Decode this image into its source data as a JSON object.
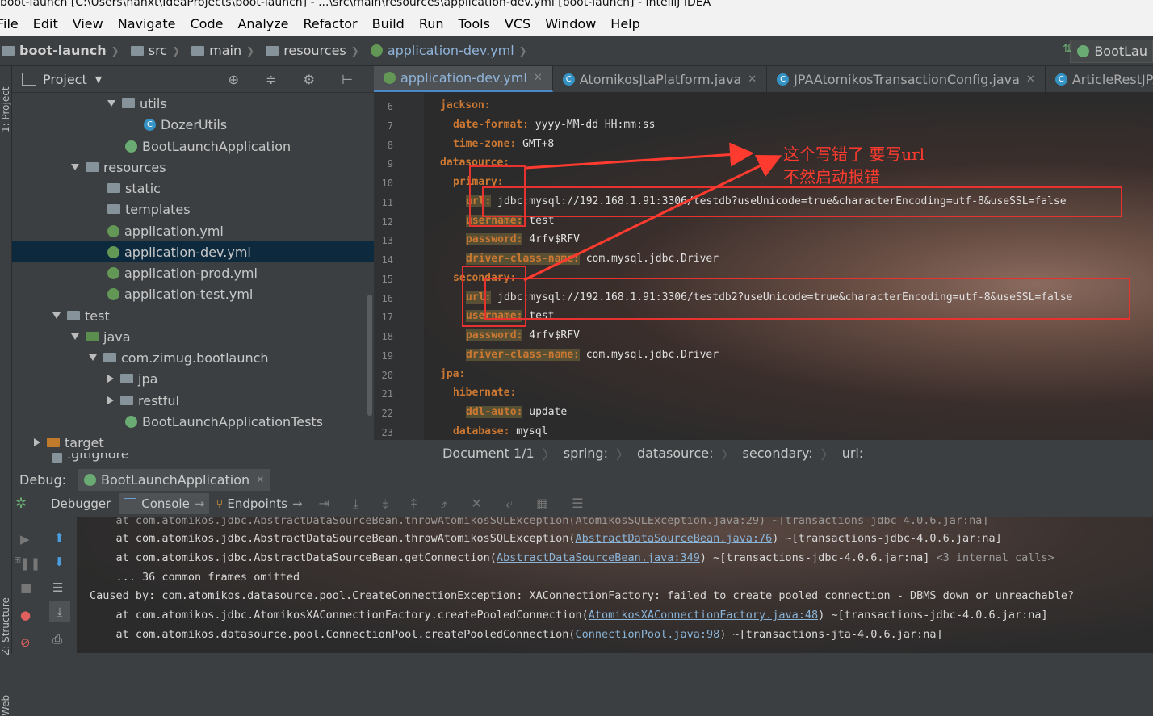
{
  "window": {
    "title": "boot-launch [C:\\Users\\hanxt\\IdeaProjects\\boot-launch] - ...\\src\\main\\resources\\application-dev.yml [boot-launch] - IntelliJ IDEA"
  },
  "menu": [
    "File",
    "Edit",
    "View",
    "Navigate",
    "Code",
    "Analyze",
    "Refactor",
    "Build",
    "Run",
    "Tools",
    "VCS",
    "Window",
    "Help"
  ],
  "nav": {
    "crumbs": [
      "boot-launch",
      "src",
      "main",
      "resources",
      "application-dev.yml"
    ],
    "run_config": "BootLau"
  },
  "side_strip": {
    "project": "1: Project",
    "structure": "Z: Structure",
    "web": "Web"
  },
  "project": {
    "title": "Project",
    "tree": [
      {
        "label": "utils",
        "type": "folder"
      },
      {
        "label": "DozerUtils",
        "type": "class"
      },
      {
        "label": "BootLaunchApplication",
        "type": "spring"
      },
      {
        "label": "resources",
        "type": "folder"
      },
      {
        "label": "static",
        "type": "folder"
      },
      {
        "label": "templates",
        "type": "folder"
      },
      {
        "label": "application.yml",
        "type": "yml"
      },
      {
        "label": "application-dev.yml",
        "type": "yml",
        "selected": true
      },
      {
        "label": "application-prod.yml",
        "type": "yml"
      },
      {
        "label": "application-test.yml",
        "type": "yml"
      },
      {
        "label": "test",
        "type": "folder"
      },
      {
        "label": "java",
        "type": "folder"
      },
      {
        "label": "com.zimug.bootlaunch",
        "type": "folder"
      },
      {
        "label": "jpa",
        "type": "folder"
      },
      {
        "label": "restful",
        "type": "folder"
      },
      {
        "label": "BootLaunchApplicationTests",
        "type": "spring"
      },
      {
        "label": "target",
        "type": "folder"
      },
      {
        "label": ".gitignore",
        "type": "file"
      }
    ]
  },
  "tabs": [
    {
      "label": "application-dev.yml",
      "active": true
    },
    {
      "label": "AtomikosJtaPlatform.java"
    },
    {
      "label": "JPAAtomikosTransactionConfig.java"
    },
    {
      "label": "ArticleRestJPAService"
    }
  ],
  "editor": {
    "lines": [
      {
        "n": "6",
        "indent": 1,
        "key": "jackson:",
        "val": ""
      },
      {
        "n": "7",
        "indent": 2,
        "key": "date-format:",
        "val": " yyyy-MM-dd HH:mm:ss"
      },
      {
        "n": "8",
        "indent": 2,
        "key": "time-zone:",
        "val": " GMT+8"
      },
      {
        "n": "9",
        "indent": 1,
        "key": "datasource:",
        "val": ""
      },
      {
        "n": "10",
        "indent": 2,
        "key": "primary:",
        "val": ""
      },
      {
        "n": "11",
        "indent": 3,
        "key": "url:",
        "val": " jdbc:mysql://192.168.1.91:3306/testdb?useUnicode=true&characterEncoding=utf-8&useSSL=false"
      },
      {
        "n": "12",
        "indent": 3,
        "key": "username:",
        "val": " test"
      },
      {
        "n": "13",
        "indent": 3,
        "key": "password:",
        "val": " 4rfv$RFV"
      },
      {
        "n": "14",
        "indent": 3,
        "key": "driver-class-name:",
        "val": " com.mysql.jdbc.Driver"
      },
      {
        "n": "15",
        "indent": 2,
        "key": "secondary:",
        "val": ""
      },
      {
        "n": "16",
        "indent": 3,
        "key": "url:",
        "val": " jdbc:mysql://192.168.1.91:3306/testdb2?useUnicode=true&characterEncoding=utf-8&useSSL=false"
      },
      {
        "n": "17",
        "indent": 3,
        "key": "username:",
        "val": " test"
      },
      {
        "n": "18",
        "indent": 3,
        "key": "password:",
        "val": " 4rfv$RFV"
      },
      {
        "n": "19",
        "indent": 3,
        "key": "driver-class-name:",
        "val": " com.mysql.jdbc.Driver"
      },
      {
        "n": "20",
        "indent": 1,
        "key": "jpa:",
        "val": ""
      },
      {
        "n": "21",
        "indent": 2,
        "key": "hibernate:",
        "val": ""
      },
      {
        "n": "22",
        "indent": 3,
        "key": "ddl-auto:",
        "val": " update"
      },
      {
        "n": "23",
        "indent": 2,
        "key": "database:",
        "val": " mysql"
      }
    ],
    "annotation_line1": "这个写错了 要写url",
    "annotation_line2": "不然启动报错"
  },
  "breadcrumb": [
    "Document 1/1",
    "spring:",
    "datasource:",
    "secondary:",
    "url:"
  ],
  "debug": {
    "label": "Debug:",
    "config": "BootLaunchApplication",
    "tabs": [
      "Debugger",
      "Console",
      "Endpoints"
    ]
  },
  "console": {
    "lines": [
      {
        "pre": "    at com.atomikos.jdbc.AbstractDataSourceBean.throwAtomikosSQLException(",
        "link": "AbstractDataSourceBean.java:76",
        "post": ") ~[transactions-jdbc-4.0.6.jar:na]",
        "extra": ""
      },
      {
        "pre": "    at com.atomikos.jdbc.AbstractDataSourceBean.getConnection(",
        "link": "AbstractDataSourceBean.java:349",
        "post": ") ~[transactions-jdbc-4.0.6.jar:na] ",
        "extra": "<3 internal calls>"
      },
      {
        "pre": "    ... 36 common frames omitted",
        "link": "",
        "post": "",
        "extra": ""
      },
      {
        "pre": "Caused by: com.atomikos.datasource.pool.CreateConnectionException: XAConnectionFactory: failed to create pooled connection - DBMS down or unreachable?",
        "link": "",
        "post": "",
        "extra": ""
      },
      {
        "pre": "    at com.atomikos.jdbc.AtomikosXAConnectionFactory.createPooledConnection(",
        "link": "AtomikosXAConnectionFactory.java:48",
        "post": ") ~[transactions-jdbc-4.0.6.jar:na]",
        "extra": ""
      },
      {
        "pre": "    at com.atomikos.datasource.pool.ConnectionPool.createPooledConnection(",
        "link": "ConnectionPool.java:98",
        "post": ") ~[transactions-jta-4.0.6.jar:na]",
        "extra": ""
      }
    ]
  }
}
